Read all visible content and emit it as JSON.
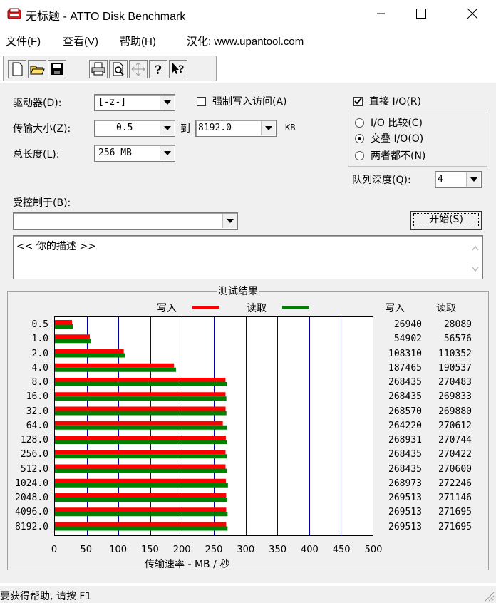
{
  "window": {
    "title": "无标题 - ATTO Disk Benchmark"
  },
  "menu": [
    "文件(F)",
    "查看(V)",
    "帮助(H)",
    "汉化: www.upantool.com"
  ],
  "form": {
    "drive_label": "驱动器(D):",
    "drive_value": "[-z-]",
    "force_write_label": "强制写入访问(A)",
    "force_write_checked": false,
    "direct_io_label": "直接 I/O(R)",
    "direct_io_checked": true,
    "transfer_label": "传输大小(Z):",
    "transfer_from": "0.5",
    "to_label": "到",
    "transfer_to": "8192.0",
    "transfer_unit": "KB",
    "total_label": "总长度(L):",
    "total_value": "256 MB",
    "io_options": [
      {
        "label": "I/O 比较(C)",
        "selected": false
      },
      {
        "label": "交叠 I/O(O)",
        "selected": true
      },
      {
        "label": "两者都不(N)",
        "selected": false
      }
    ],
    "queue_label": "队列深度(Q):",
    "queue_value": "4",
    "controlled_label": "受控制于(B):",
    "controlled_value": "",
    "start_label": "开始(S)",
    "description": "<<  你的描述   >>"
  },
  "results": {
    "group_title": "测试结果",
    "legend_write": "写入",
    "legend_read": "读取",
    "col_write": "写入",
    "col_read": "读取",
    "write_color": "#ff0000",
    "read_color": "#008000",
    "grid_color": "#0000a0",
    "xlabel": "传输速率 - MB / 秒"
  },
  "chart_data": {
    "type": "bar",
    "orientation": "horizontal",
    "categories": [
      "0.5",
      "1.0",
      "2.0",
      "4.0",
      "8.0",
      "16.0",
      "32.0",
      "64.0",
      "128.0",
      "256.0",
      "512.0",
      "1024.0",
      "2048.0",
      "4096.0",
      "8192.0"
    ],
    "series": [
      {
        "name": "写入",
        "values": [
          26940,
          54902,
          108310,
          187465,
          268435,
          268435,
          268570,
          264220,
          268931,
          268435,
          268435,
          268973,
          269513,
          269513,
          269513
        ]
      },
      {
        "name": "读取",
        "values": [
          28089,
          56576,
          110352,
          190537,
          270483,
          269833,
          269880,
          270612,
          270744,
          270422,
          270600,
          272246,
          271146,
          271695,
          271695
        ]
      }
    ],
    "xlabel": "传输速率 - MB / 秒",
    "xticks": [
      "0",
      "50",
      "100",
      "150",
      "200",
      "250",
      "300",
      "350",
      "400",
      "450",
      "500"
    ],
    "xlim": [
      0,
      500
    ],
    "value_unit_divisor": 1000,
    "grid": true,
    "legend": "top"
  },
  "status": {
    "text": "要获得帮助, 请按 F1"
  }
}
